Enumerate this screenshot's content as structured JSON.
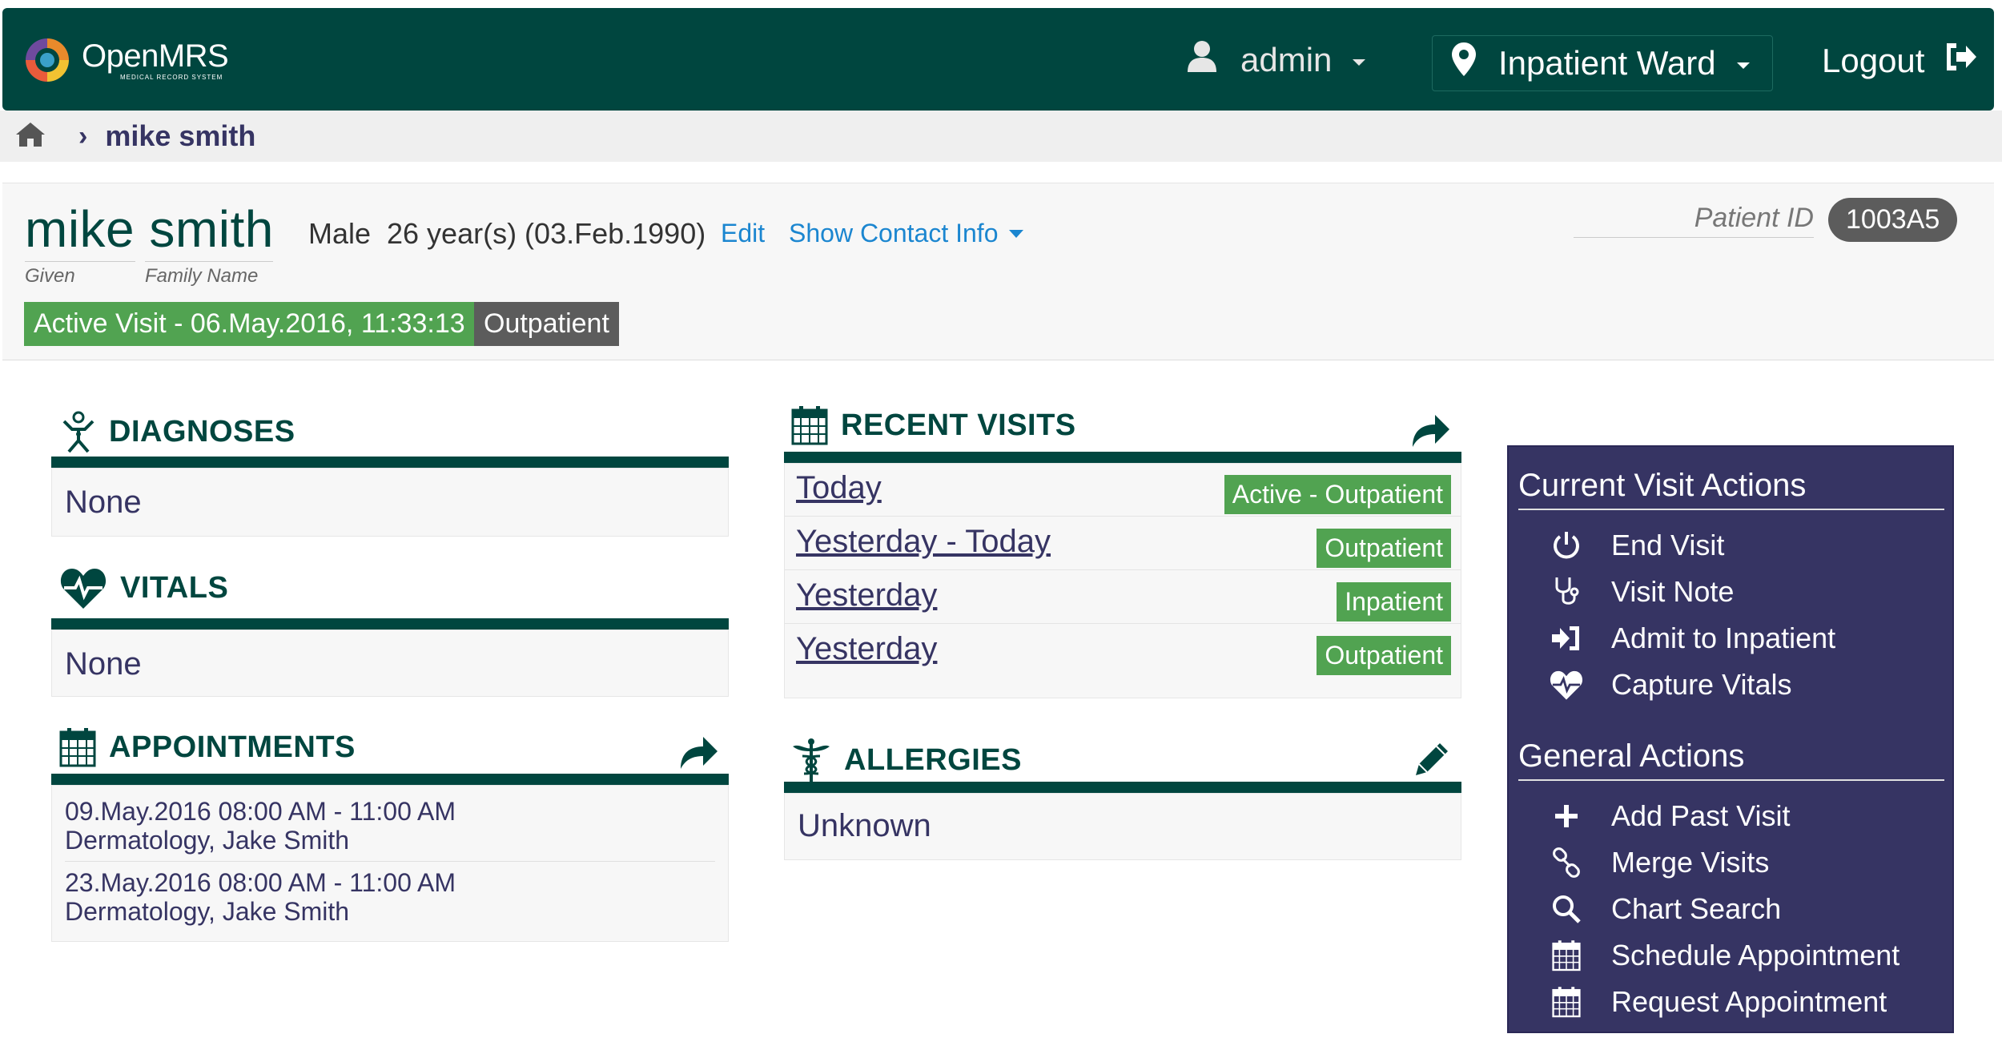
{
  "header": {
    "logo_name": "OpenMRS",
    "logo_sub": "MEDICAL RECORD SYSTEM",
    "user": "admin",
    "location": "Inpatient Ward",
    "logout": "Logout"
  },
  "breadcrumb": {
    "patient": "mike smith"
  },
  "patient": {
    "name": "mike smith",
    "given_label": "Given",
    "family_label": "Family Name",
    "gender": "Male",
    "age": "26 year(s) (03.Feb.1990)",
    "edit": "Edit",
    "show_contact": "Show Contact Info",
    "id_label": "Patient ID",
    "id_value": "1003A5",
    "active_visit": "Active Visit - 06.May.2016, 11:33:13",
    "visit_type": "Outpatient"
  },
  "diagnoses": {
    "title": "DIAGNOSES",
    "value": "None"
  },
  "vitals": {
    "title": "VITALS",
    "value": "None"
  },
  "appointments": {
    "title": "APPOINTMENTS",
    "items": [
      {
        "when": "09.May.2016 08:00 AM - 11:00 AM",
        "what": "Dermatology, Jake Smith"
      },
      {
        "when": "23.May.2016 08:00 AM - 11:00 AM",
        "what": "Dermatology, Jake Smith"
      }
    ]
  },
  "recent_visits": {
    "title": "RECENT VISITS",
    "items": [
      {
        "label": "Today",
        "status": "Active - Outpatient"
      },
      {
        "label": "Yesterday - Today",
        "status": "Outpatient"
      },
      {
        "label": "Yesterday",
        "status": "Inpatient"
      },
      {
        "label": "Yesterday",
        "status": "Outpatient"
      }
    ]
  },
  "allergies": {
    "title": "ALLERGIES",
    "value": "Unknown"
  },
  "actions": {
    "current_title": "Current Visit Actions",
    "current": [
      "End Visit",
      "Visit Note",
      "Admit to Inpatient",
      "Capture Vitals"
    ],
    "general_title": "General Actions",
    "general": [
      "Add Past Visit",
      "Merge Visits",
      "Chart Search",
      "Schedule Appointment",
      "Request Appointment"
    ]
  },
  "colors": {
    "header": "#00463f",
    "accent_green": "#51a351",
    "panel": "#363463",
    "link_blue": "#1b86d0"
  }
}
